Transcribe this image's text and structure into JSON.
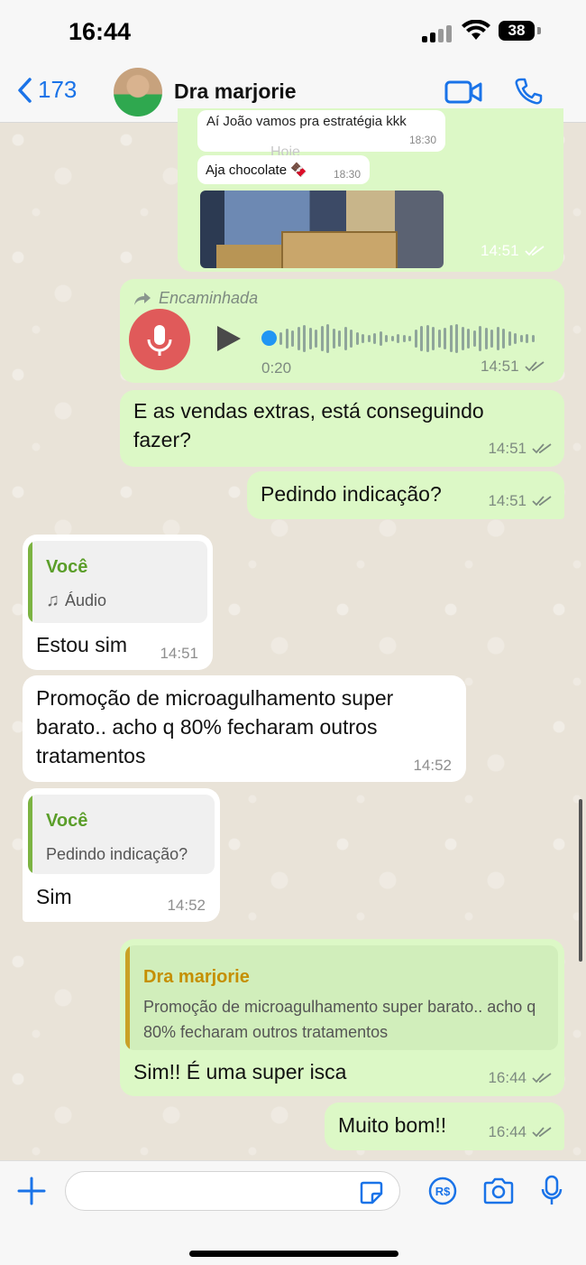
{
  "status_bar": {
    "time": "16:44",
    "battery": "38"
  },
  "header": {
    "back_count": "173",
    "contact_name": "Dra marjorie"
  },
  "messages": {
    "m0": {
      "text1": "Aí João vamos pra estratégia kkk",
      "time1": "18:30",
      "day": "Hoje",
      "text2": "Aja chocolate 🍫",
      "time2": "18:30",
      "time": "14:51"
    },
    "m1": {
      "forwarded": "Encaminhada",
      "duration": "0:20",
      "time": "14:51"
    },
    "m2": {
      "text": "E as vendas extras, está conseguindo fazer?",
      "time": "14:51"
    },
    "m3": {
      "text": "Pedindo indicação?",
      "time": "14:51"
    },
    "m4": {
      "quote_name": "Você",
      "quote_text": "Áudio",
      "text": "Estou sim",
      "time": "14:51"
    },
    "m5": {
      "text": "Promoção de microagulhamento super barato.. acho q 80% fecharam outros tratamentos",
      "time": "14:52"
    },
    "m6": {
      "quote_name": "Você",
      "quote_text": "Pedindo indicação?",
      "text": "Sim",
      "time": "14:52"
    },
    "m7": {
      "quote_name": "Dra marjorie",
      "quote_text": "Promoção de microagulhamento super barato.. acho q 80% fecharam outros tratamentos",
      "text": "Sim!! É uma super isca",
      "time": "16:44"
    },
    "m8": {
      "text": "Muito bom!!",
      "time": "16:44"
    }
  },
  "colors": {
    "accent": "#1a73e8",
    "outgoing": "#dcf8c6",
    "incoming": "#ffffff",
    "quote_you": "#7cb342",
    "quote_contact": "#c9a227"
  },
  "icons": [
    "chevron-left-icon",
    "video-icon",
    "phone-icon",
    "forward-icon",
    "microphone-icon",
    "play-icon",
    "music-note-icon",
    "plus-icon",
    "sticker-icon",
    "payment-icon",
    "camera-icon"
  ]
}
